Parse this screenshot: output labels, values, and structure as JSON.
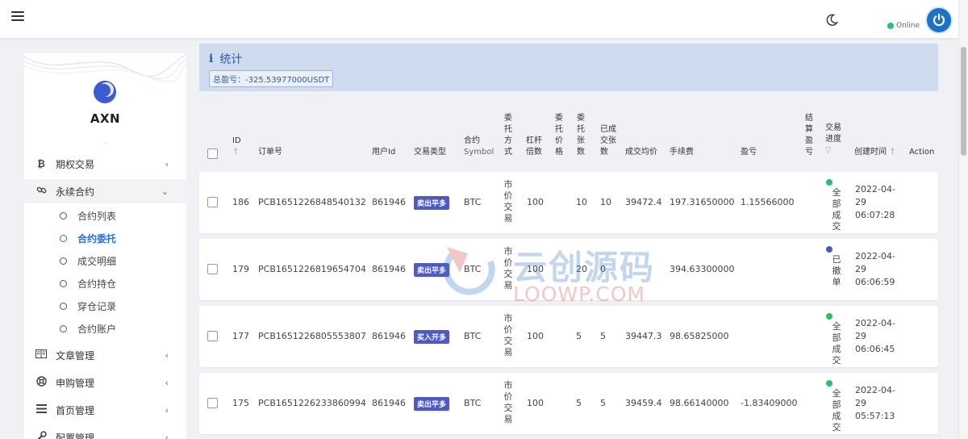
{
  "header": {
    "online_label": "Online"
  },
  "sidebar": {
    "brand": "AXN",
    "brand_dot": "·",
    "menu": [
      {
        "icon": "bitcoin-icon",
        "label": "期权交易",
        "chevron": "‹"
      },
      {
        "icon": "link-icon",
        "label": "永续合约",
        "chevron": "⌄"
      },
      {
        "icon": "book-icon",
        "label": "文章管理",
        "chevron": "‹"
      },
      {
        "icon": "life-ring-icon",
        "label": "申购管理",
        "chevron": "‹"
      },
      {
        "icon": "list-icon",
        "label": "首页管理",
        "chevron": "‹"
      },
      {
        "icon": "wrench-icon",
        "label": "配置管理",
        "chevron": "‹"
      }
    ],
    "submenu": [
      "合约列表",
      "合约委托",
      "成交明细",
      "合约持仓",
      "穿仓记录",
      "合约账户"
    ]
  },
  "stats": {
    "icon": "i",
    "title": "统计",
    "total_profit": "总盈亏：-325.53977000USDT"
  },
  "table": {
    "headers": {
      "id": "ID",
      "order_no": "订单号",
      "user_id": "用户Id",
      "trade_type": "交易类型",
      "symbol_cn": "合约",
      "symbol_en": "Symbol",
      "order_mode": "委托方式",
      "leverage": "杠杆倍数",
      "order_price": "委托价格",
      "order_qty": "委托张数",
      "filled_qty": "已成交张数",
      "avg_price": "成交均价",
      "fee": "手续费",
      "pnl": "盈亏",
      "settle_pnl": "结算盈亏",
      "progress": "交易进度",
      "created": "创建时间",
      "action": "Action"
    },
    "rows": [
      {
        "id": "186",
        "order_no": "PCB1651226848540132",
        "user_id": "861946",
        "type": "卖出平多",
        "symbol": "BTC",
        "mode": "市价交易",
        "leverage": "100",
        "qty": "10",
        "filled": "10",
        "avg": "39472.4",
        "fee": "197.31650000",
        "pnl": "1.15566000",
        "status": "全部成交",
        "status_color": "#27c26c",
        "date": "2022-04-",
        "date2": "29",
        "time": "06:07:28"
      },
      {
        "id": "179",
        "order_no": "PCB1651226819654704",
        "user_id": "861946",
        "type": "卖出平多",
        "symbol": "BTC",
        "mode": "市价交易",
        "leverage": "100",
        "qty": "20",
        "filled": "0",
        "avg": "",
        "fee": "394.63300000",
        "pnl": "",
        "status": "已撤单",
        "status_color": "#4d59c9",
        "date": "2022-04-",
        "date2": "29",
        "time": "06:06:59"
      },
      {
        "id": "177",
        "order_no": "PCB1651226805553807",
        "user_id": "861946",
        "type": "买入开多",
        "symbol": "BTC",
        "mode": "市价交易",
        "leverage": "100",
        "qty": "5",
        "filled": "5",
        "avg": "39447.3",
        "fee": "98.65825000",
        "pnl": "",
        "status": "全部成交",
        "status_color": "#27c26c",
        "date": "2022-04-",
        "date2": "29",
        "time": "06:06:45"
      },
      {
        "id": "175",
        "order_no": "PCB1651226233860994",
        "user_id": "861946",
        "type": "卖出平多",
        "symbol": "BTC",
        "mode": "市价交易",
        "leverage": "100",
        "qty": "5",
        "filled": "5",
        "avg": "39459.4",
        "fee": "98.66140000",
        "pnl": "-1.83409000",
        "status": "全部成交",
        "status_color": "#27c26c",
        "date": "2022-04-",
        "date2": "29",
        "time": "05:57:13"
      }
    ]
  },
  "watermark": {
    "cn": "云创源码",
    "en": "LOOWP.COM"
  },
  "colors": {
    "accent": "#2f6fd6",
    "badge": "#4d59c9",
    "online": "#27c26c",
    "stats_bg": "#cfdcf0"
  }
}
